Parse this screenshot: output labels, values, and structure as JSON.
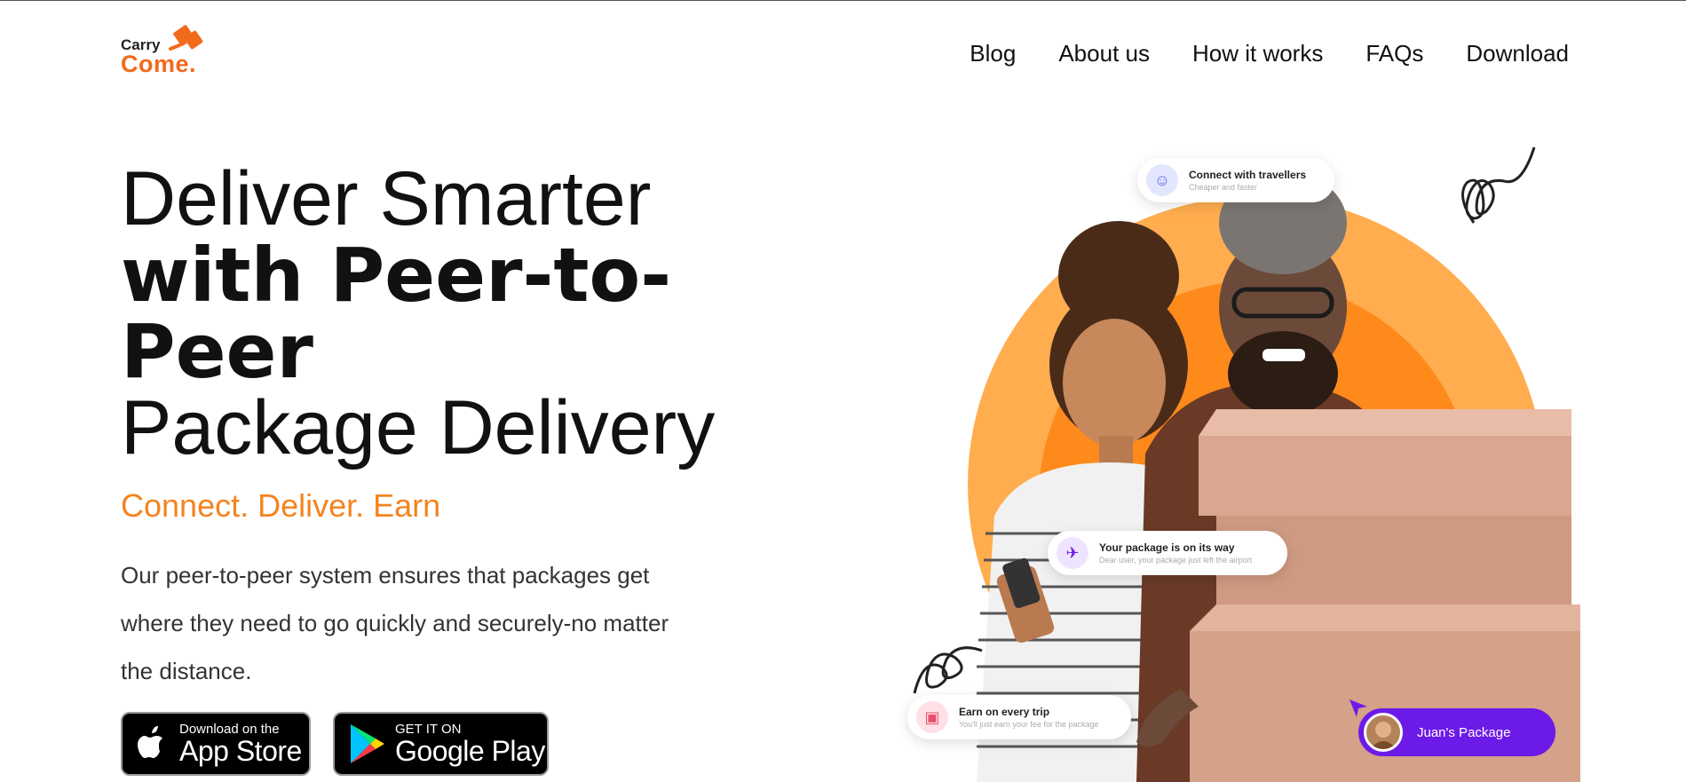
{
  "brand": {
    "line1": "Carry",
    "line2": "Come.",
    "accent": "#f26a1b"
  },
  "nav": {
    "items": [
      {
        "label": "Blog"
      },
      {
        "label": "About us"
      },
      {
        "label": "How it works"
      },
      {
        "label": "FAQs"
      },
      {
        "label": "Download"
      }
    ]
  },
  "hero": {
    "title_line1": "Deliver Smarter",
    "title_line2": "with Peer-to-",
    "title_line3": "Peer",
    "title_line4": "Package Delivery",
    "tagline": "Connect. Deliver. Earn",
    "description": "Our peer-to-peer system ensures that packages get where they need to go quickly and securely-no matter the distance."
  },
  "stores": {
    "appstore": {
      "small": "Download on the",
      "big": "App Store",
      "icon": "apple-icon"
    },
    "googleplay": {
      "small": "GET IT ON",
      "big": "Google Play",
      "icon": "google-play-icon"
    }
  },
  "cards": {
    "connect": {
      "title": "Connect with travellers",
      "subtitle": "Cheaper and faster",
      "icon": "users-icon"
    },
    "onway": {
      "title": "Your package is on its way",
      "subtitle": "Dear user, your package just left the airport",
      "icon": "airplane-icon"
    },
    "earn": {
      "title": "Earn on every trip",
      "subtitle": "You'll just earn your fee for the package",
      "icon": "cash-icon"
    },
    "juan": {
      "label": "Juan's Package"
    }
  },
  "colors": {
    "orange": "#f5831f",
    "purple": "#6c1ae8"
  }
}
